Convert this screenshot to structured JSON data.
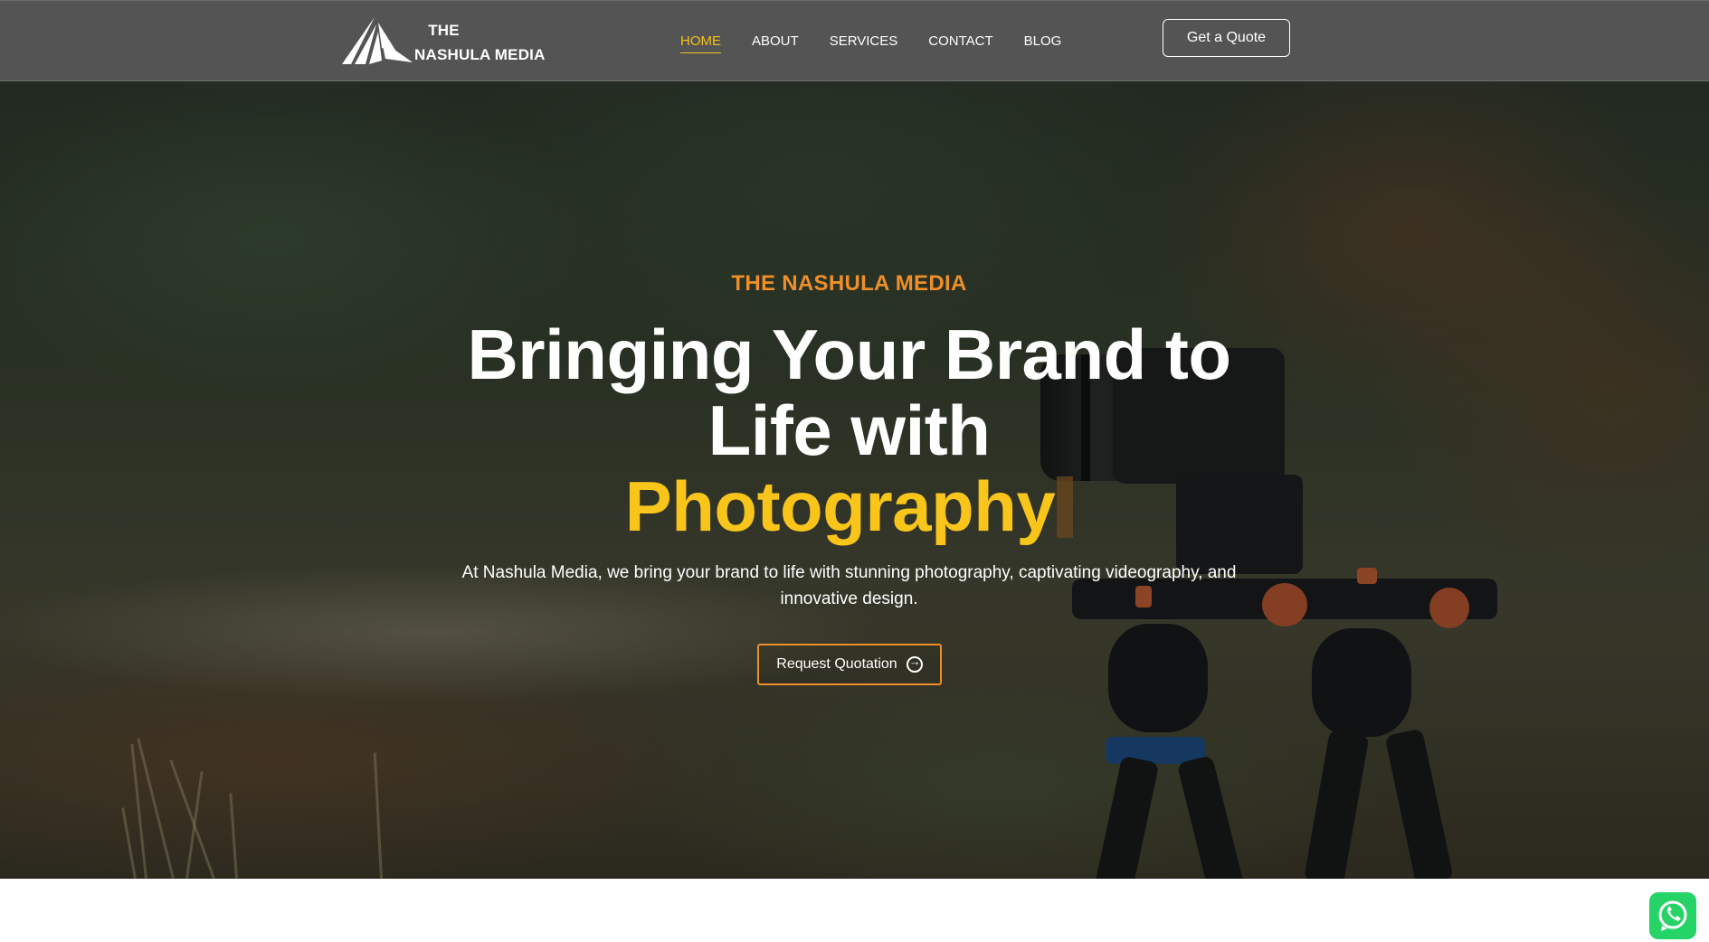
{
  "header": {
    "logo_line1": "THE",
    "logo_line2": "NASHULA MEDIA",
    "nav": [
      {
        "label": "HOME",
        "active": true
      },
      {
        "label": "ABOUT",
        "active": false
      },
      {
        "label": "SERVICES",
        "active": false
      },
      {
        "label": "CONTACT",
        "active": false
      },
      {
        "label": "BLOG",
        "active": false
      }
    ],
    "quote_button": "Get a Quote"
  },
  "hero": {
    "eyebrow": "THE NASHULA MEDIA",
    "headline_line1": "Bringing Your Brand to",
    "headline_line2": "Life with",
    "headline_highlight": "Photography",
    "description": "At Nashula Media, we bring your brand to life with stunning photography, captivating videography, and innovative design.",
    "cta_label": "Request Quotation",
    "cta_icon": "arrow-circle-right-icon"
  },
  "floating": {
    "whatsapp_icon": "whatsapp-icon"
  },
  "colors": {
    "accent_yellow": "#f9c51b",
    "accent_orange": "#ef8f2a",
    "header_bg": "#545454",
    "whatsapp_green": "#25d366"
  }
}
